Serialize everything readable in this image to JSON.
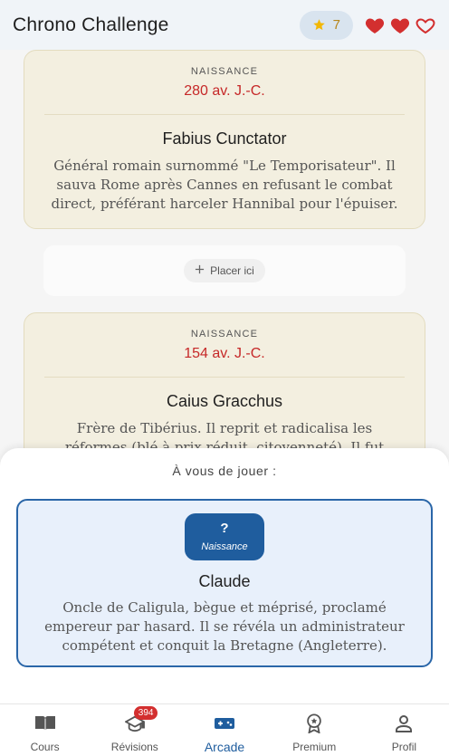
{
  "header": {
    "title": "Chrono Challenge",
    "score": "7",
    "lives": [
      "full",
      "full",
      "empty"
    ]
  },
  "timeline": [
    {
      "label": "NAISSANCE",
      "date": "280 av. J.-C.",
      "name": "Fabius Cunctator",
      "description": "Général romain surnommé \"Le Temporisateur\". Il sauva Rome après Cannes en refusant le combat direct, préférant harceler Hannibal pour l'épuiser."
    },
    {
      "label": "NAISSANCE",
      "date": "154 av. J.-C.",
      "name": "Caius Gracchus",
      "description": "Frère de Tibérius. Il reprit et radicalisa les réformes (blé à prix réduit, citoyenneté). Il fut également tué."
    }
  ],
  "placeholder": {
    "label": "Placer ici"
  },
  "sheet": {
    "title": "À vous de jouer :",
    "card": {
      "badge_mark": "?",
      "badge_label": "Naissance",
      "name": "Claude",
      "description": "Oncle de Caligula, bègue et méprisé, proclamé empereur par hasard. Il se révéla un administrateur compétent et conquit la Bretagne (Angleterre)."
    }
  },
  "nav": {
    "items": [
      {
        "label": "Cours",
        "icon": "book-icon"
      },
      {
        "label": "Révisions",
        "icon": "graduation-cap-icon",
        "badge": "394"
      },
      {
        "label": "Arcade",
        "icon": "gamepad-icon",
        "active": true
      },
      {
        "label": "Premium",
        "icon": "award-icon"
      },
      {
        "label": "Profil",
        "icon": "person-icon"
      }
    ]
  },
  "colors": {
    "accent": "#1f5d9e",
    "date_red": "#c62828",
    "heart_red": "#d32f2f",
    "star_gold": "#f2b705"
  }
}
